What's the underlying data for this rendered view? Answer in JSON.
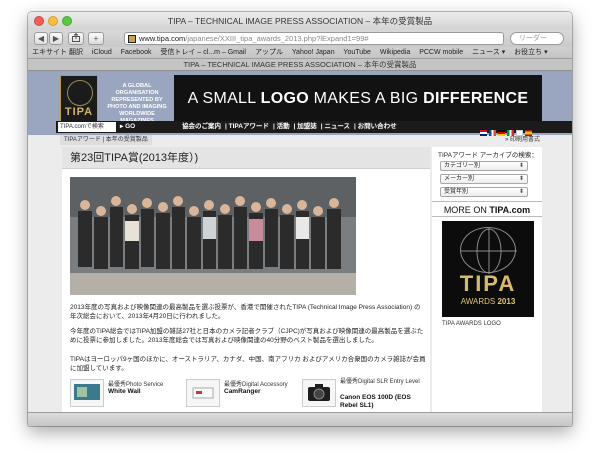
{
  "window": {
    "title": "TIPA – TECHNICAL IMAGE PRESS ASSOCIATION – 本年の受賞製品"
  },
  "toolbar": {
    "back": "◀",
    "forward": "▶",
    "url_host": "www.tipa.com",
    "url_path": "/japanese/XXIII_tipa_awards_2013.php?lExpand1=99#",
    "search_placeholder": "リーダー"
  },
  "bookmarks": [
    "エキサイト 翻訳",
    "iCloud",
    "Facebook",
    "受信トレイ – cl...m – Gmail",
    "アップル",
    "Yahoo! Japan",
    "YouTube",
    "Wikipedia",
    "PCCW mobile",
    "ニュース ▾",
    "お役立ち ▾"
  ],
  "tab": {
    "label": "TIPA – TECHNICAL IMAGE PRESS ASSOCIATION – 本年の受賞製品"
  },
  "header": {
    "logo_text": "TIPA",
    "tagline": "A GLOBAL ORGANISATION REPRESENTED BY PHOTO AND IMAGING WORLDWIDE MAGAZINES",
    "banner_pre": "A SMALL ",
    "banner_logo": "LOGO",
    "banner_mid": " MAKES A BIG ",
    "banner_diff": "DIFFERENCE",
    "search_value": "TIPA.comで検索",
    "go_label": "▸ GO",
    "menu": [
      "協会のご案内",
      "TIPAアワード",
      "活動",
      "加盟誌",
      "ニュース",
      "お問い合わせ"
    ]
  },
  "breadcrumb": {
    "text": "TIPAアワード | 本年の受賞製品",
    "print": "» 印刷用書式"
  },
  "main": {
    "title": "第23回TIPA賞(2013年度）)",
    "para1": "2013年度の写真および映像関連の最高製品を選ぶ投票が、香港で開催されたTIPA (Technical Image Press Association) の年次総会において、2013年4月20日に行われました。",
    "para2": "今年度のTIPA総会ではTIPA加盟の雑誌27社と日本のカメラ記者クラブ（CJPC)が写真および映像関連の最高製品を選ぶために投票に参加しました。2013年度総会では写真および映像関連の40分野のベスト製品を選出しました。",
    "para3": "TIPAはヨーロッパ9ヶ国のほかに、オーストラリア、カナダ、中国、南アフリカ およびアメリカ合衆国のカメラ雑誌が会員に加盟しています。",
    "products": [
      {
        "category": "最優秀Photo Service",
        "name": "White Wall"
      },
      {
        "category": "最優秀Digital Accessory",
        "name": "CamRanger"
      },
      {
        "category": "最優秀Digital SLR Entry Level",
        "name": "Canon EOS 100D (EOS Rebel SL1)"
      }
    ]
  },
  "sidebar": {
    "archive_title": "TIPAアワード アーカイブの検索：",
    "dropdowns": [
      "カテゴリー別",
      "メーカー別",
      "受賞年別"
    ],
    "more_prefix": "MORE ON ",
    "more_brand": "TIPA.com",
    "award_tipa": "TIPA",
    "award_awards": "AWARDS ",
    "award_year": "2013",
    "award_label": "TIPA AWARDS LOGO"
  },
  "colors": {
    "banner_bg": "#9aa6bf",
    "gold": "#d8bb6a",
    "dark": "#121212"
  }
}
